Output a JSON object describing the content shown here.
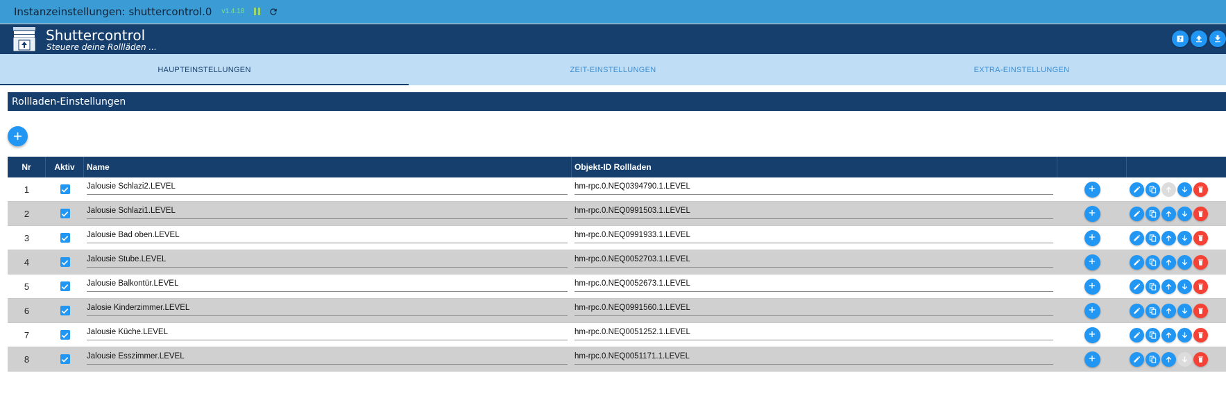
{
  "window": {
    "title": "Instanzeinstellungen: shuttercontrol.0",
    "version": "v1.4.18"
  },
  "app": {
    "title": "Shuttercontrol",
    "subtitle": "Steuere deine Rollläden ...",
    "icons": [
      "help-icon",
      "upload-icon",
      "download-icon"
    ]
  },
  "tabs": [
    {
      "label": "HAUPTEINSTELLUNGEN",
      "active": true
    },
    {
      "label": "ZEIT-EINSTELLUNGEN",
      "active": false
    },
    {
      "label": "EXTRA-EINSTELLUNGEN",
      "active": false
    }
  ],
  "section": {
    "title": "Rollladen-Einstellungen"
  },
  "table": {
    "headers": {
      "nr": "Nr",
      "aktiv": "Aktiv",
      "name": "Name",
      "objekt": "Objekt-ID Rollladen"
    },
    "rows": [
      {
        "nr": "1",
        "aktiv": true,
        "name": "Jalousie Schlazi2.LEVEL",
        "objekt": "hm-rpc.0.NEQ0394790.1.LEVEL"
      },
      {
        "nr": "2",
        "aktiv": true,
        "name": "Jalousie Schlazi1.LEVEL",
        "objekt": "hm-rpc.0.NEQ0991503.1.LEVEL"
      },
      {
        "nr": "3",
        "aktiv": true,
        "name": "Jalousie Bad oben.LEVEL",
        "objekt": "hm-rpc.0.NEQ0991933.1.LEVEL"
      },
      {
        "nr": "4",
        "aktiv": true,
        "name": "Jalousie Stube.LEVEL",
        "objekt": "hm-rpc.0.NEQ0052703.1.LEVEL"
      },
      {
        "nr": "5",
        "aktiv": true,
        "name": "Jalousie Balkontür.LEVEL",
        "objekt": "hm-rpc.0.NEQ0052673.1.LEVEL"
      },
      {
        "nr": "6",
        "aktiv": true,
        "name": "Jalosie Kinderzimmer.LEVEL",
        "objekt": "hm-rpc.0.NEQ0991560.1.LEVEL"
      },
      {
        "nr": "7",
        "aktiv": true,
        "name": "Jalousie Küche.LEVEL",
        "objekt": "hm-rpc.0.NEQ0051252.1.LEVEL"
      },
      {
        "nr": "8",
        "aktiv": true,
        "name": "Jalousie Esszimmer.LEVEL",
        "objekt": "hm-rpc.0.NEQ0051171.1.LEVEL"
      }
    ]
  },
  "colors": {
    "accent": "#2196f3",
    "header": "#173f6e",
    "delete": "#f44336",
    "tabbar": "#bfdef6"
  }
}
